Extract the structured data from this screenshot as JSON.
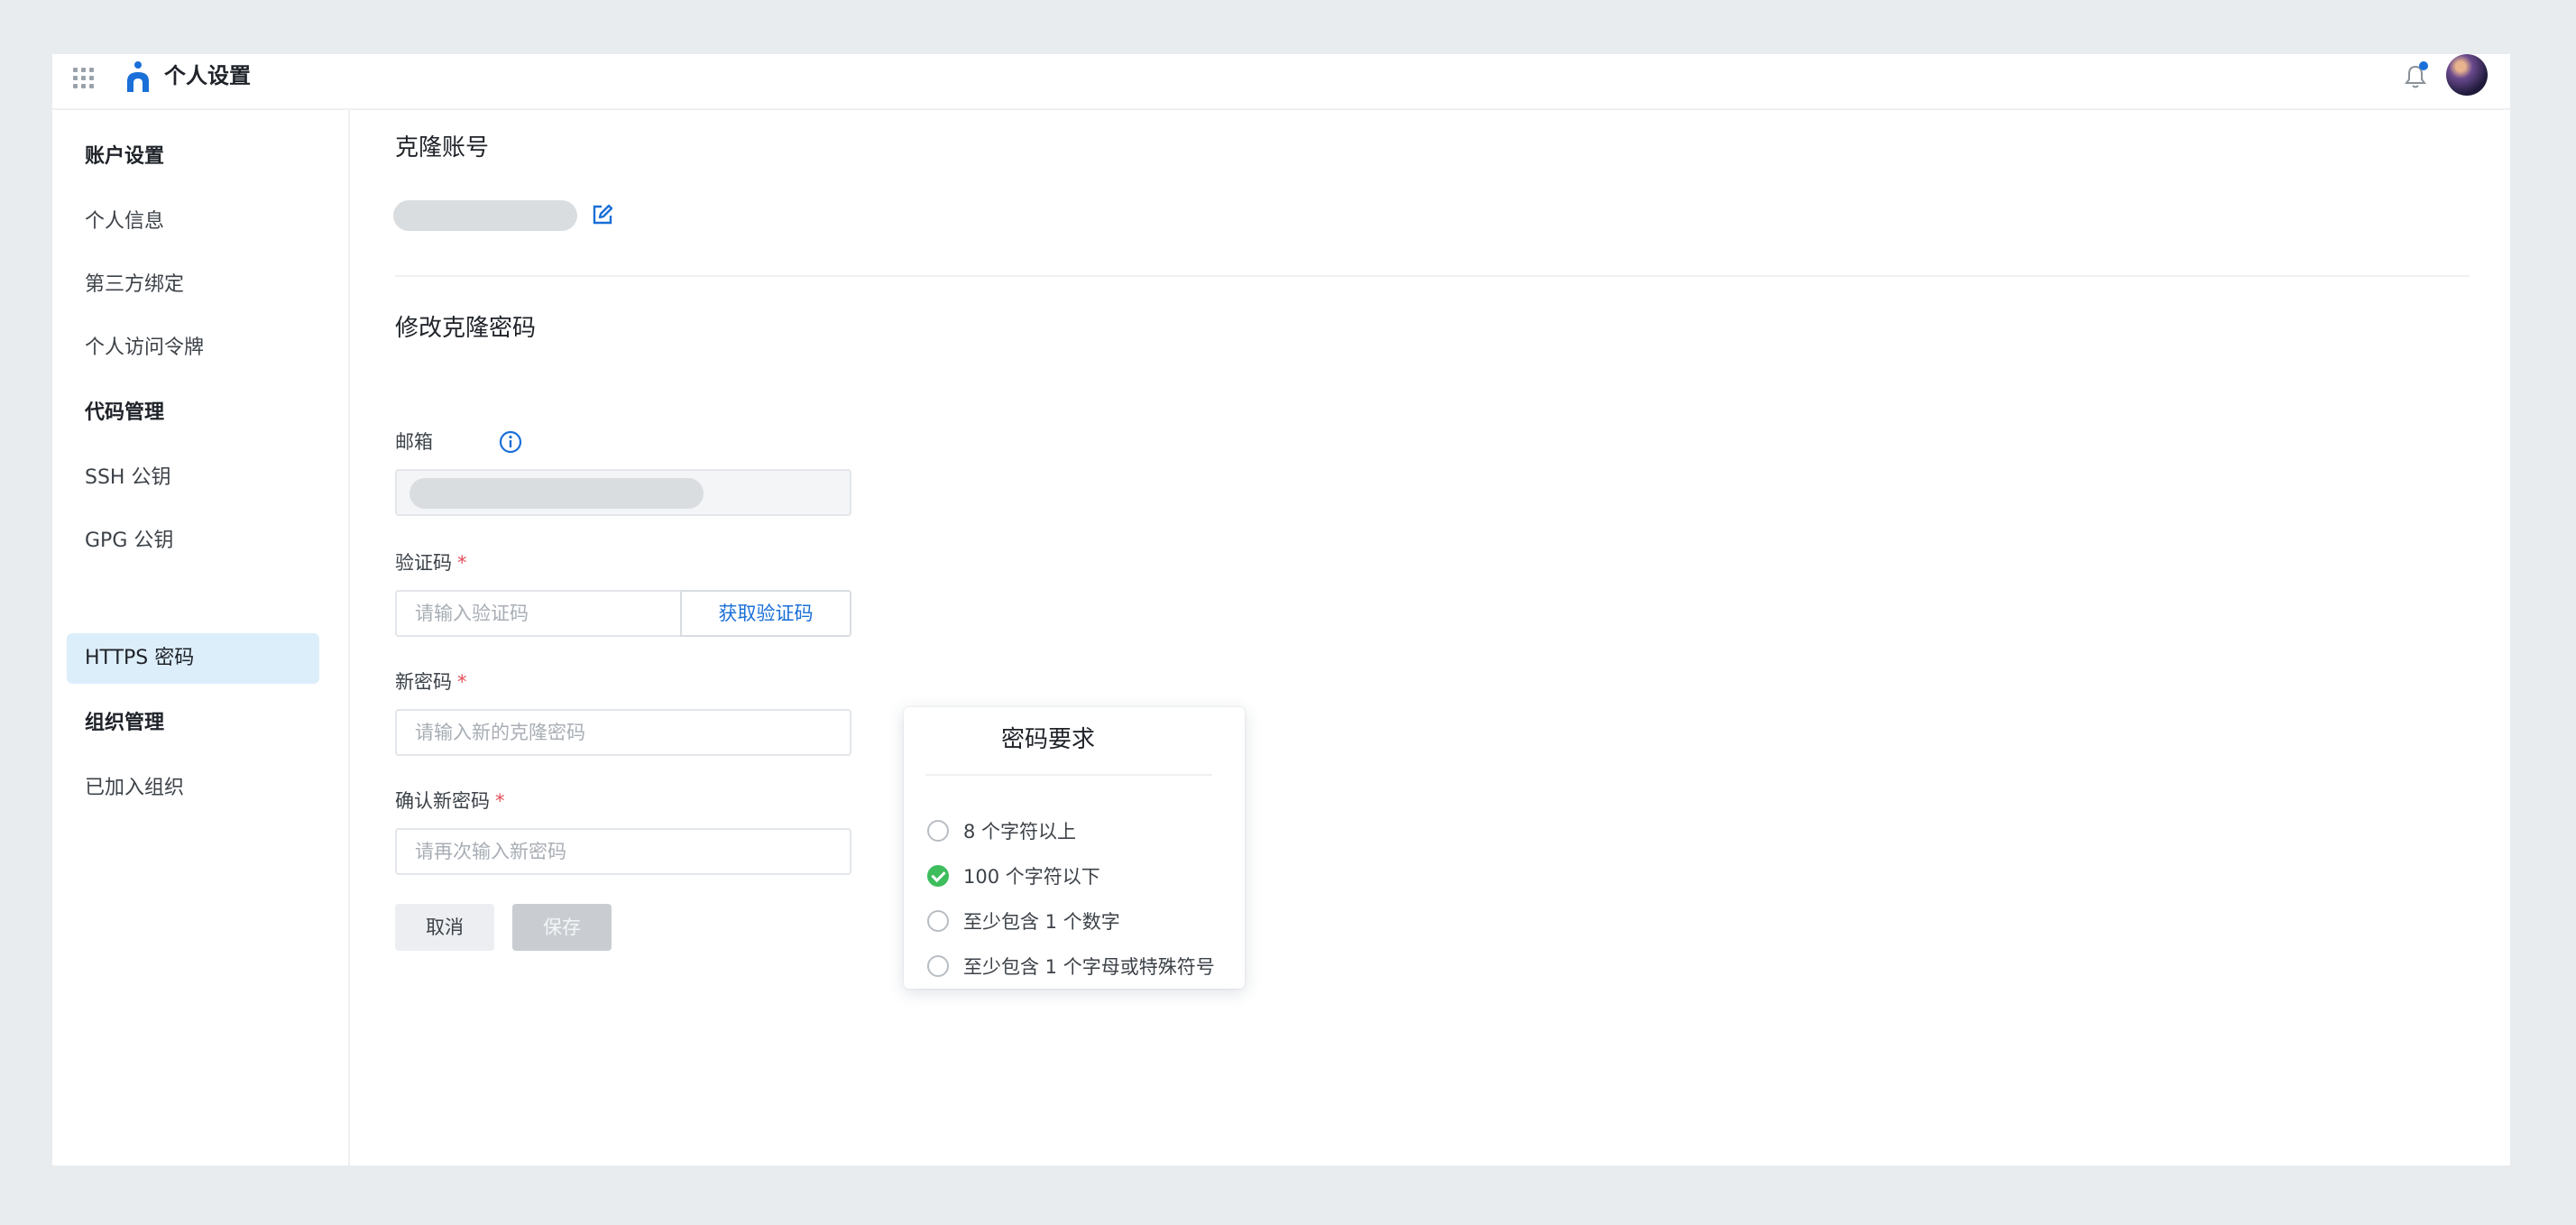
{
  "header": {
    "title": "个人设置",
    "apps_icon": "apps-grid-icon",
    "logo_icon": "app-logo-icon",
    "bell_icon": "bell-icon",
    "has_notification_dot": true
  },
  "sidebar": {
    "items": [
      {
        "label": "账户设置",
        "type": "group"
      },
      {
        "label": "个人信息",
        "type": "item"
      },
      {
        "label": "第三方绑定",
        "type": "item"
      },
      {
        "label": "个人访问令牌",
        "type": "item"
      },
      {
        "label": "代码管理",
        "type": "group"
      },
      {
        "label": "SSH 公钥",
        "type": "item"
      },
      {
        "label": "GPG 公钥",
        "type": "item"
      },
      {
        "label": "HTTPS 密码",
        "type": "item",
        "active": true
      },
      {
        "label": "组织管理",
        "type": "group"
      },
      {
        "label": "已加入组织",
        "type": "item"
      }
    ]
  },
  "clone_account": {
    "title": "克隆账号",
    "edit_icon": "edit-icon"
  },
  "change_password": {
    "title": "修改克隆密码",
    "email": {
      "label": "邮箱",
      "icon": "info-icon"
    },
    "code": {
      "label": "验证码",
      "required_mark": "*",
      "placeholder": "请输入验证码",
      "button": "获取验证码"
    },
    "new_password": {
      "label": "新密码",
      "required_mark": "*",
      "placeholder": "请输入新的克隆密码"
    },
    "confirm_password": {
      "label": "确认新密码",
      "required_mark": "*",
      "placeholder": "请再次输入新密码"
    },
    "cancel": "取消",
    "save": "保存"
  },
  "password_requirements": {
    "title": "密码要求",
    "items": [
      {
        "text": "8 个字符以上",
        "met": false
      },
      {
        "text": "100 个字符以下",
        "met": true
      },
      {
        "text": "至少包含 1 个数字",
        "met": false
      },
      {
        "text": "至少包含 1 个字母或特殊符号",
        "met": false
      }
    ]
  },
  "colors": {
    "accent": "#1a6fd8",
    "active_nav_bg": "#ddeefb",
    "success": "#3dbd5c",
    "required": "#e34d59",
    "notification_dot": "#1a6fd8"
  }
}
